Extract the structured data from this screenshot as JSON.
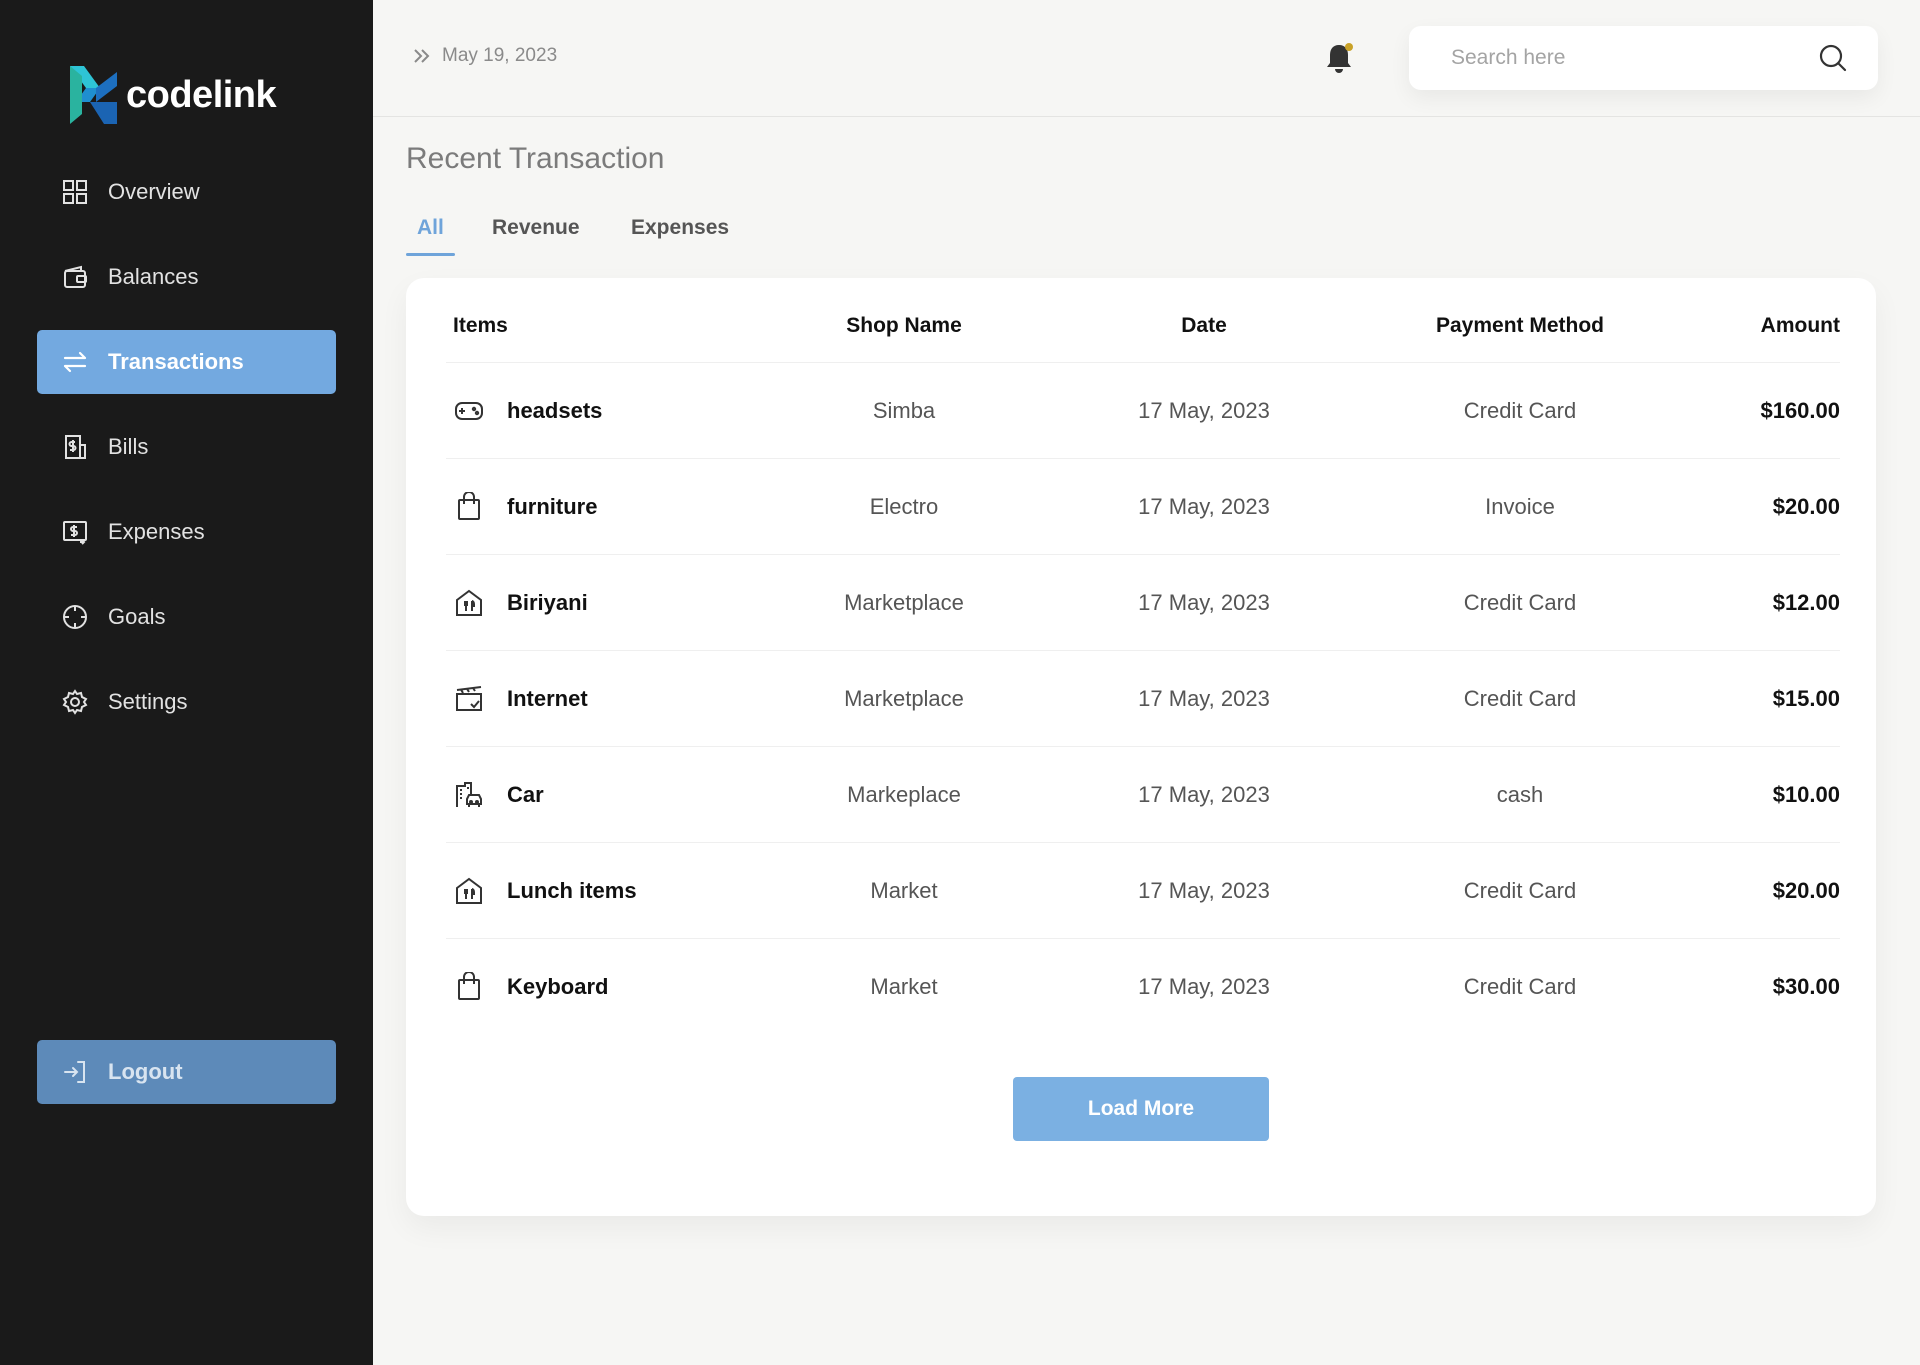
{
  "brand": {
    "name": "codelink"
  },
  "sidebar": {
    "items": [
      {
        "label": "Overview",
        "icon": "grid-icon"
      },
      {
        "label": "Balances",
        "icon": "wallet-icon"
      },
      {
        "label": "Transactions",
        "icon": "transfer-icon",
        "active": true
      },
      {
        "label": "Bills",
        "icon": "bill-icon"
      },
      {
        "label": "Expenses",
        "icon": "expense-icon"
      },
      {
        "label": "Goals",
        "icon": "target-icon"
      },
      {
        "label": "Settings",
        "icon": "gear-icon"
      }
    ],
    "logout_label": "Logout"
  },
  "header": {
    "date": "May 19, 2023",
    "search_placeholder": "Search here"
  },
  "main": {
    "title": "Recent Transaction",
    "tabs": [
      {
        "label": "All",
        "active": true
      },
      {
        "label": "Revenue"
      },
      {
        "label": "Expenses"
      }
    ],
    "table": {
      "columns": [
        "Items",
        "Shop Name",
        "Date",
        "Payment Method",
        "Amount"
      ],
      "rows": [
        {
          "icon": "gamepad-icon",
          "item": "headsets",
          "shop": "Simba",
          "date": "17 May, 2023",
          "method": "Credit Card",
          "amount": "$160.00"
        },
        {
          "icon": "shopping-bag-icon",
          "item": "furniture",
          "shop": "Electro",
          "date": "17 May, 2023",
          "method": "Invoice",
          "amount": "$20.00"
        },
        {
          "icon": "restaurant-icon",
          "item": "Biriyani",
          "shop": "Marketplace",
          "date": "17 May, 2023",
          "method": "Credit Card",
          "amount": "$12.00"
        },
        {
          "icon": "clapperboard-icon",
          "item": "Internet",
          "shop": "Marketplace",
          "date": "17 May, 2023",
          "method": "Credit Card",
          "amount": "$15.00"
        },
        {
          "icon": "building-car-icon",
          "item": "Car",
          "shop": "Markeplace",
          "date": "17 May, 2023",
          "method": "cash",
          "amount": "$10.00"
        },
        {
          "icon": "restaurant-icon",
          "item": "Lunch items",
          "shop": "Market",
          "date": "17 May, 2023",
          "method": "Credit Card",
          "amount": "$20.00"
        },
        {
          "icon": "shopping-bag-icon",
          "item": "Keyboard",
          "shop": "Market",
          "date": "17 May, 2023",
          "method": "Credit Card",
          "amount": "$30.00"
        }
      ]
    },
    "load_more_label": "Load More"
  },
  "colors": {
    "sidebar_bg": "#1a1a1a",
    "accent": "#73a9e0",
    "logout_bg": "#5d8ab9",
    "page_bg": "#f6f6f4",
    "notification_dot": "#c9a227"
  }
}
